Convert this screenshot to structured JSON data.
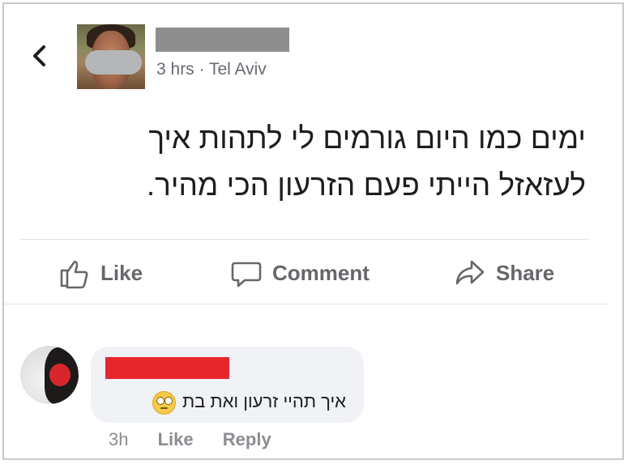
{
  "post": {
    "meta": "3 hrs · Tel Aviv",
    "text_line1": "ימים כמו היום גורמים לי לתהות איך",
    "text_line2": "לעזאזל הייתי פעם הזרעון הכי מהיר.",
    "actions": {
      "like": "Like",
      "comment": "Comment",
      "share": "Share"
    }
  },
  "comment": {
    "text": "איך תהיי זרעון ואת בת",
    "emoji": "eye-roll-emoji",
    "time": "3h",
    "like": "Like",
    "reply": "Reply"
  },
  "colors": {
    "redacted_name_post": "#8e8e8e",
    "redacted_name_comment": "#e8262e",
    "action_text": "#65676b",
    "bubble_bg": "#f0f2f5"
  }
}
